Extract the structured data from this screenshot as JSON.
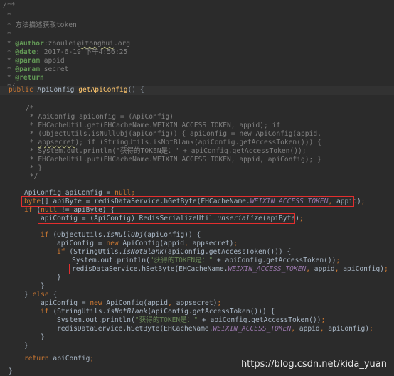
{
  "code": {
    "javadoc": [
      "/**",
      " *",
      " * 方法描述获取token",
      " *",
      " * @Author:zhoulei@itonghui.org",
      " * @date: 2017-6-19 下午4:56:25",
      " * @param appid",
      " * @param secret",
      " * @return",
      " */"
    ],
    "signature": "public ApiConfig getApiConfig() {",
    "comment_block": [
      "/*",
      " * ApiConfig apiConfig = (ApiConfig)",
      " * EHCacheUtil.get(EHCacheName.WEIXIN_ACCESS_TOKEN, appid); if",
      " * (ObjectUtils.isNullObj(apiConfig)) { apiConfig = new ApiConfig(appid,",
      " * appsecret); if (StringUtils.isNotBlank(apiConfig.getAccessToken())) {",
      " * System.out.println(\"获得的TOKEN是：\" + apiConfig.getAccessToken());",
      " * EHCacheUtil.put(EHCacheName.WEIXIN_ACCESS_TOKEN, appid, apiConfig); }",
      " * }",
      " */"
    ],
    "body": [
      "ApiConfig apiConfig = null;",
      "byte[] apiByte = redisDataService.hGetByte(EHCacheName.WEIXIN_ACCESS_TOKEN, appid);",
      "if (null != apiByte) {",
      "apiConfig = (ApiConfig) RedisSerializeUtil.unserialize(apiByte);",
      "if (ObjectUtils.isNullObj(apiConfig)) {",
      "apiConfig = new ApiConfig(appid, appsecret);",
      "if (StringUtils.isNotBlank(apiConfig.getAccessToken())) {",
      "System.out.println(\"获得的TOKEN是：\" + apiConfig.getAccessToken());",
      "redisDataService.hSetByte(EHCacheName.WEIXIN_ACCESS_TOKEN, appid, apiConfig);",
      "}",
      "}",
      "} else {",
      "apiConfig = new ApiConfig(appid, appsecret);",
      "if (StringUtils.isNotBlank(apiConfig.getAccessToken())) {",
      "System.out.println(\"获得的TOKEN是：\" + apiConfig.getAccessToken());",
      "redisDataService.hSetByte(EHCacheName.WEIXIN_ACCESS_TOKEN, appid, apiConfig);",
      "}",
      "}",
      "return apiConfig;",
      "}"
    ]
  },
  "watermark": "https://blog.csdn.net/kida_yuan",
  "colors": {
    "background": "#2b2b2b",
    "current_line": "#323232",
    "comment": "#808080",
    "javadoc_tag": "#629755",
    "keyword": "#cc7832",
    "method_declaration": "#ffc66d",
    "string": "#6a8759",
    "static_field": "#9876aa",
    "text": "#a9b7c6",
    "highlight_box": "#e32e2e"
  }
}
